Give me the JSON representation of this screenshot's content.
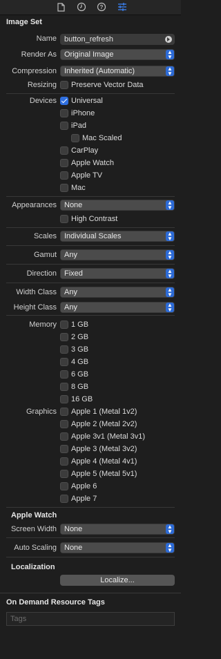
{
  "toolbar": {
    "icons": [
      "file-icon",
      "history-icon",
      "help-icon",
      "attributes-icon"
    ]
  },
  "image_set": {
    "title": "Image Set",
    "name_label": "Name",
    "name_value": "button_refresh",
    "render_as_label": "Render As",
    "render_as_value": "Original Image",
    "compression_label": "Compression",
    "compression_value": "Inherited (Automatic)",
    "resizing_label": "Resizing",
    "resizing_option": "Preserve Vector Data",
    "devices_label": "Devices",
    "devices": [
      {
        "label": "Universal",
        "checked": true
      },
      {
        "label": "iPhone",
        "checked": false
      },
      {
        "label": "iPad",
        "checked": false
      },
      {
        "label": "Mac Scaled",
        "checked": false
      },
      {
        "label": "CarPlay",
        "checked": false
      },
      {
        "label": "Apple Watch",
        "checked": false
      },
      {
        "label": "Apple TV",
        "checked": false
      },
      {
        "label": "Mac",
        "checked": false
      }
    ],
    "appearances_label": "Appearances",
    "appearances_value": "None",
    "high_contrast": "High Contrast",
    "scales_label": "Scales",
    "scales_value": "Individual Scales",
    "gamut_label": "Gamut",
    "gamut_value": "Any",
    "direction_label": "Direction",
    "direction_value": "Fixed",
    "width_class_label": "Width Class",
    "width_class_value": "Any",
    "height_class_label": "Height Class",
    "height_class_value": "Any",
    "memory_label": "Memory",
    "memory": [
      "1 GB",
      "2 GB",
      "3 GB",
      "4 GB",
      "6 GB",
      "8 GB",
      "16 GB"
    ],
    "graphics_label": "Graphics",
    "graphics": [
      "Apple 1 (Metal 1v2)",
      "Apple 2 (Metal 2v2)",
      "Apple 3v1 (Metal 3v1)",
      "Apple 3 (Metal 3v2)",
      "Apple 4 (Metal 4v1)",
      "Apple 5 (Metal 5v1)",
      "Apple 6",
      "Apple 7"
    ]
  },
  "apple_watch": {
    "title": "Apple Watch",
    "screen_width_label": "Screen Width",
    "screen_width_value": "None",
    "auto_scaling_label": "Auto Scaling",
    "auto_scaling_value": "None"
  },
  "localization": {
    "title": "Localization",
    "button": "Localize..."
  },
  "odr": {
    "title": "On Demand Resource Tags",
    "placeholder": "Tags"
  },
  "colors": {
    "background": "#1e1e1e",
    "accent": "#2f6fe0",
    "active_tab": "#3b82f6"
  }
}
